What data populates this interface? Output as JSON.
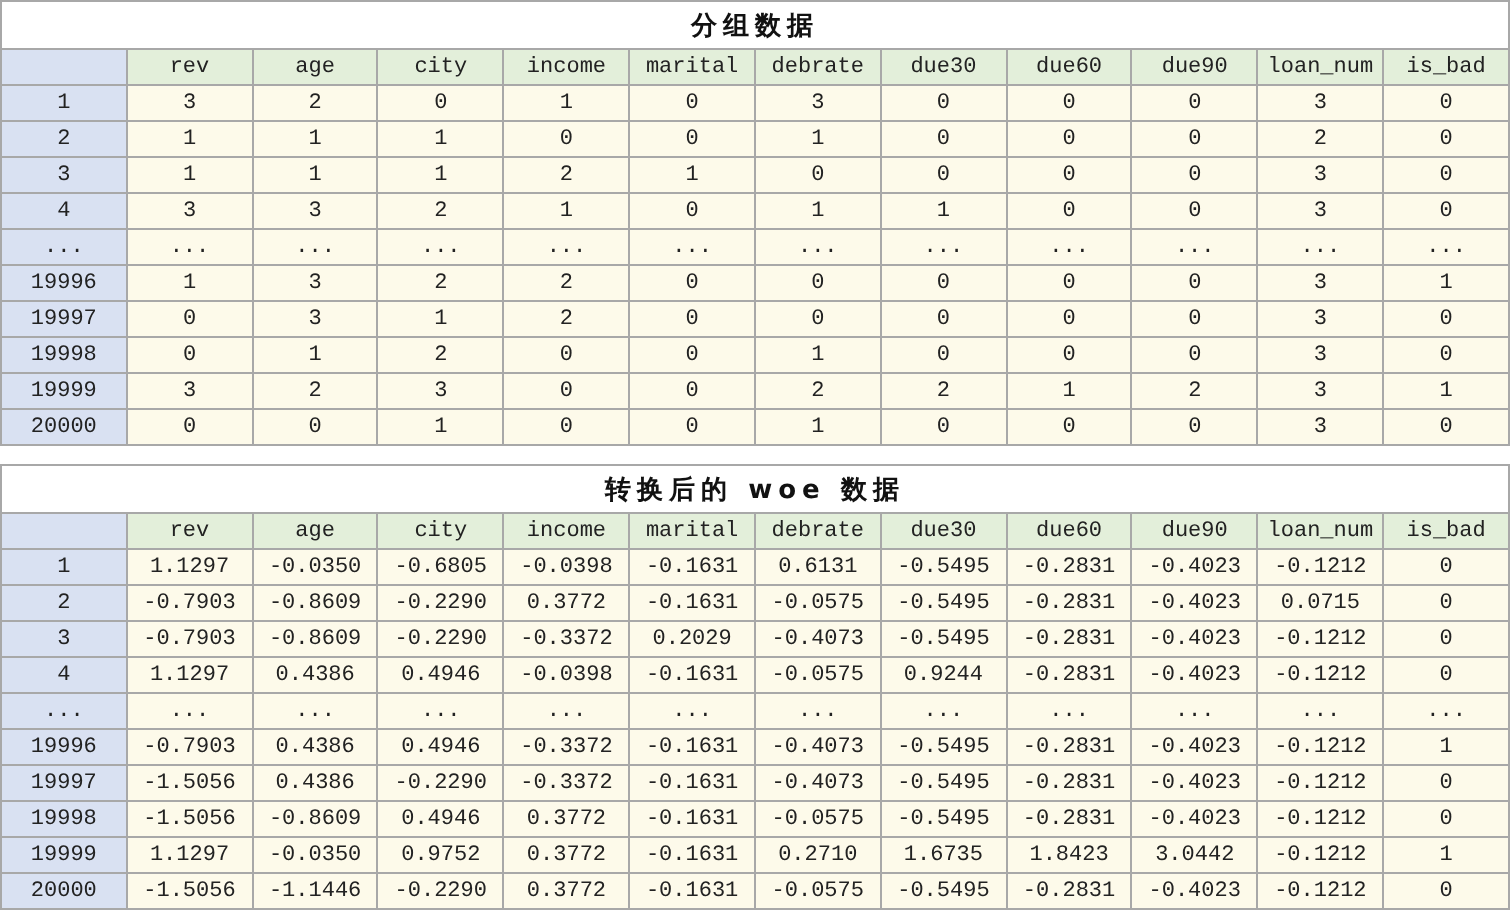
{
  "tables": [
    {
      "title": "分组数据",
      "columns": [
        "rev",
        "age",
        "city",
        "income",
        "marital",
        "debrate",
        "due30",
        "due60",
        "due90",
        "loan_num",
        "is_bad"
      ],
      "rows": [
        {
          "index": "1",
          "cells": [
            "3",
            "2",
            "0",
            "1",
            "0",
            "3",
            "0",
            "0",
            "0",
            "3",
            "0"
          ]
        },
        {
          "index": "2",
          "cells": [
            "1",
            "1",
            "1",
            "0",
            "0",
            "1",
            "0",
            "0",
            "0",
            "2",
            "0"
          ]
        },
        {
          "index": "3",
          "cells": [
            "1",
            "1",
            "1",
            "2",
            "1",
            "0",
            "0",
            "0",
            "0",
            "3",
            "0"
          ]
        },
        {
          "index": "4",
          "cells": [
            "3",
            "3",
            "2",
            "1",
            "0",
            "1",
            "1",
            "0",
            "0",
            "3",
            "0"
          ]
        },
        {
          "index": "...",
          "cells": [
            "...",
            "...",
            "...",
            "...",
            "...",
            "...",
            "...",
            "...",
            "...",
            "...",
            "..."
          ]
        },
        {
          "index": "19996",
          "cells": [
            "1",
            "3",
            "2",
            "2",
            "0",
            "0",
            "0",
            "0",
            "0",
            "3",
            "1"
          ]
        },
        {
          "index": "19997",
          "cells": [
            "0",
            "3",
            "1",
            "2",
            "0",
            "0",
            "0",
            "0",
            "0",
            "3",
            "0"
          ]
        },
        {
          "index": "19998",
          "cells": [
            "0",
            "1",
            "2",
            "0",
            "0",
            "1",
            "0",
            "0",
            "0",
            "3",
            "0"
          ]
        },
        {
          "index": "19999",
          "cells": [
            "3",
            "2",
            "3",
            "0",
            "0",
            "2",
            "2",
            "1",
            "2",
            "3",
            "1"
          ]
        },
        {
          "index": "20000",
          "cells": [
            "0",
            "0",
            "1",
            "0",
            "0",
            "1",
            "0",
            "0",
            "0",
            "3",
            "0"
          ]
        }
      ]
    },
    {
      "title": "转换后的 woe 数据",
      "columns": [
        "rev",
        "age",
        "city",
        "income",
        "marital",
        "debrate",
        "due30",
        "due60",
        "due90",
        "loan_num",
        "is_bad"
      ],
      "rows": [
        {
          "index": "1",
          "cells": [
            "1.1297",
            "-0.0350",
            "-0.6805",
            "-0.0398",
            "-0.1631",
            "0.6131",
            "-0.5495",
            "-0.2831",
            "-0.4023",
            "-0.1212",
            "0"
          ]
        },
        {
          "index": "2",
          "cells": [
            "-0.7903",
            "-0.8609",
            "-0.2290",
            "0.3772",
            "-0.1631",
            "-0.0575",
            "-0.5495",
            "-0.2831",
            "-0.4023",
            "0.0715",
            "0"
          ]
        },
        {
          "index": "3",
          "cells": [
            "-0.7903",
            "-0.8609",
            "-0.2290",
            "-0.3372",
            "0.2029",
            "-0.4073",
            "-0.5495",
            "-0.2831",
            "-0.4023",
            "-0.1212",
            "0"
          ]
        },
        {
          "index": "4",
          "cells": [
            "1.1297",
            "0.4386",
            "0.4946",
            "-0.0398",
            "-0.1631",
            "-0.0575",
            "0.9244",
            "-0.2831",
            "-0.4023",
            "-0.1212",
            "0"
          ]
        },
        {
          "index": "...",
          "cells": [
            "...",
            "...",
            "...",
            "...",
            "...",
            "...",
            "...",
            "...",
            "...",
            "...",
            "..."
          ]
        },
        {
          "index": "19996",
          "cells": [
            "-0.7903",
            "0.4386",
            "0.4946",
            "-0.3372",
            "-0.1631",
            "-0.4073",
            "-0.5495",
            "-0.2831",
            "-0.4023",
            "-0.1212",
            "1"
          ]
        },
        {
          "index": "19997",
          "cells": [
            "-1.5056",
            "0.4386",
            "-0.2290",
            "-0.3372",
            "-0.1631",
            "-0.4073",
            "-0.5495",
            "-0.2831",
            "-0.4023",
            "-0.1212",
            "0"
          ]
        },
        {
          "index": "19998",
          "cells": [
            "-1.5056",
            "-0.8609",
            "0.4946",
            "0.3772",
            "-0.1631",
            "-0.0575",
            "-0.5495",
            "-0.2831",
            "-0.4023",
            "-0.1212",
            "0"
          ]
        },
        {
          "index": "19999",
          "cells": [
            "1.1297",
            "-0.0350",
            "0.9752",
            "0.3772",
            "-0.1631",
            "0.2710",
            "1.6735",
            "1.8423",
            "3.0442",
            "-0.1212",
            "1"
          ]
        },
        {
          "index": "20000",
          "cells": [
            "-1.5056",
            "-1.1446",
            "-0.2290",
            "0.3772",
            "-0.1631",
            "-0.0575",
            "-0.5495",
            "-0.2831",
            "-0.4023",
            "-0.1212",
            "0"
          ]
        }
      ]
    }
  ]
}
